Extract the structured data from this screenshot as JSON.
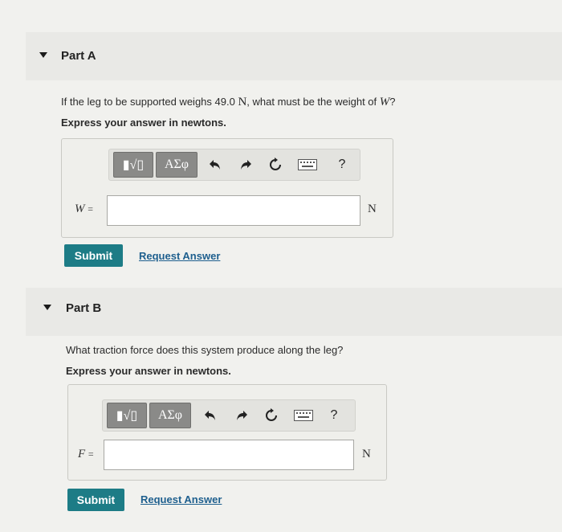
{
  "part_a": {
    "title": "Part A",
    "prompt_pre": "If the leg to be supported weighs 49.0 ",
    "prompt_unit": "N",
    "prompt_mid": ", what must be the weight of ",
    "prompt_var": "W",
    "prompt_post": "?",
    "instruction": "Express your answer in newtons.",
    "var": "W",
    "eq": "=",
    "unit": "N",
    "submit": "Submit",
    "request": "Request Answer"
  },
  "part_b": {
    "title": "Part B",
    "prompt": "What traction force does this system produce along the leg?",
    "instruction": "Express your answer in newtons.",
    "var": "F",
    "eq": "=",
    "unit": "N",
    "submit": "Submit",
    "request": "Request Answer"
  },
  "toolbar": {
    "template_glyph": "▮√▯",
    "greek": "ΑΣφ",
    "help": "?",
    "icons": [
      "undo-icon",
      "redo-icon",
      "reset-icon",
      "keyboard-icon",
      "help-icon"
    ]
  }
}
